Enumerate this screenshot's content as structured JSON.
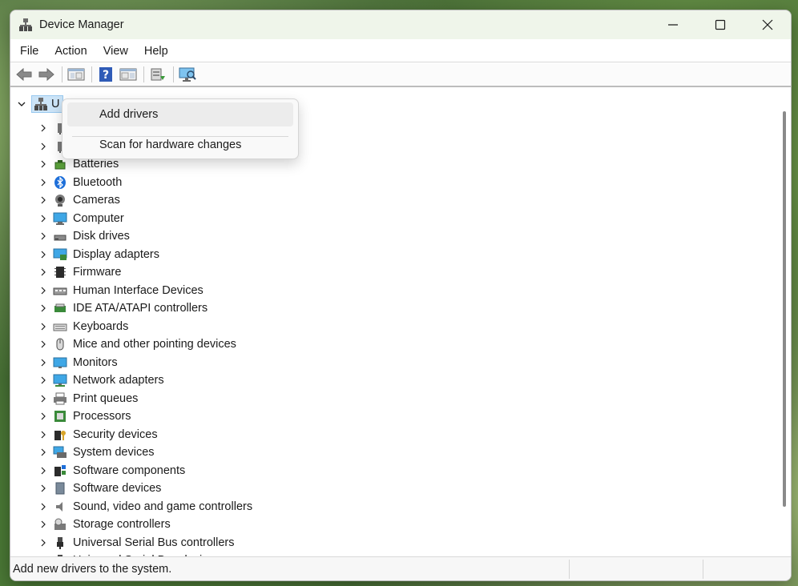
{
  "window": {
    "title": "Device Manager"
  },
  "menubar": {
    "items": [
      "File",
      "Action",
      "View",
      "Help"
    ]
  },
  "toolbar": {
    "icons": [
      "back-arrow-icon",
      "forward-arrow-icon",
      "show-hide-console-tree-icon",
      "help-icon",
      "properties-pane-icon",
      "update-driver-icon",
      "scan-hardware-icon"
    ]
  },
  "tree": {
    "root_label": "U",
    "items": [
      {
        "label": "",
        "icon": "audio-inputs-icon"
      },
      {
        "label": "",
        "icon": "audio-outputs-icon"
      },
      {
        "label": "Batteries",
        "icon": "battery-icon"
      },
      {
        "label": "Bluetooth",
        "icon": "bluetooth-icon"
      },
      {
        "label": "Cameras",
        "icon": "camera-icon"
      },
      {
        "label": "Computer",
        "icon": "computer-icon"
      },
      {
        "label": "Disk drives",
        "icon": "disk-drive-icon"
      },
      {
        "label": "Display adapters",
        "icon": "display-adapter-icon"
      },
      {
        "label": "Firmware",
        "icon": "firmware-icon"
      },
      {
        "label": "Human Interface Devices",
        "icon": "hid-icon"
      },
      {
        "label": "IDE ATA/ATAPI controllers",
        "icon": "ide-controller-icon"
      },
      {
        "label": "Keyboards",
        "icon": "keyboard-icon"
      },
      {
        "label": "Mice and other pointing devices",
        "icon": "mouse-icon"
      },
      {
        "label": "Monitors",
        "icon": "monitor-icon"
      },
      {
        "label": "Network adapters",
        "icon": "network-adapter-icon"
      },
      {
        "label": "Print queues",
        "icon": "printer-icon"
      },
      {
        "label": "Processors",
        "icon": "processor-icon"
      },
      {
        "label": "Security devices",
        "icon": "security-device-icon"
      },
      {
        "label": "System devices",
        "icon": "system-device-icon"
      },
      {
        "label": "Software components",
        "icon": "software-component-icon"
      },
      {
        "label": "Software devices",
        "icon": "software-device-icon"
      },
      {
        "label": "Sound, video and game controllers",
        "icon": "sound-icon"
      },
      {
        "label": "Storage controllers",
        "icon": "storage-controller-icon"
      },
      {
        "label": "Universal Serial Bus controllers",
        "icon": "usb-icon"
      },
      {
        "label": "Universal Serial Bus devices",
        "icon": "usb-icon"
      }
    ]
  },
  "context_menu": {
    "items": [
      "Add drivers",
      "Scan for hardware changes"
    ]
  },
  "statusbar": {
    "text": "Add new drivers to the system."
  }
}
